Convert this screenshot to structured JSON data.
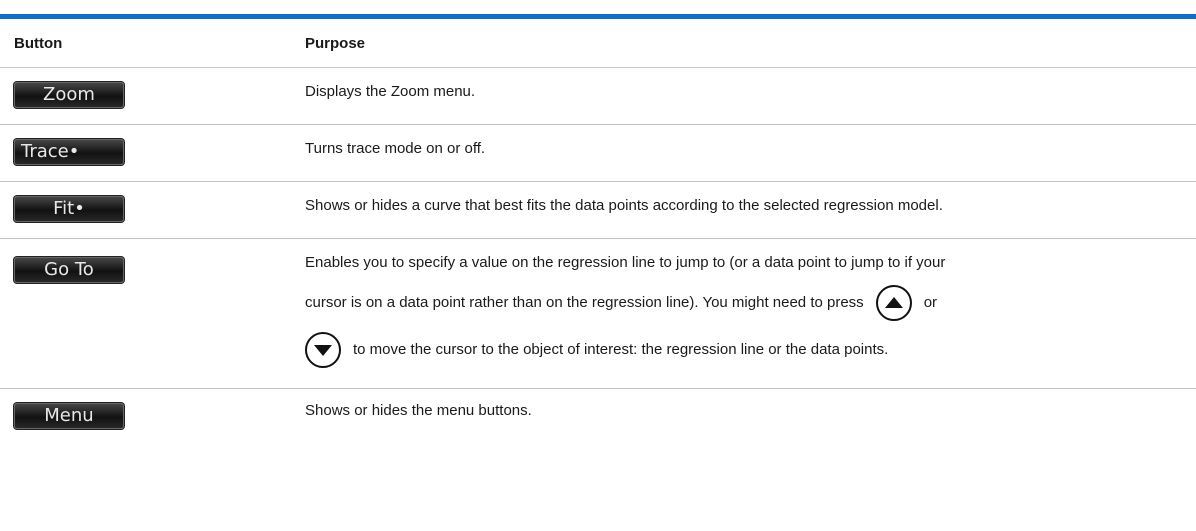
{
  "table": {
    "headers": {
      "button": "Button",
      "purpose": "Purpose"
    },
    "rows": [
      {
        "button_label": "Zoom",
        "purpose": "Displays the Zoom menu."
      },
      {
        "button_label": "Trace•",
        "purpose": "Turns trace mode on or off."
      },
      {
        "button_label": "Fit•",
        "purpose": "Shows or hides a curve that best fits the data points according to the selected regression model."
      },
      {
        "button_label": "Go To",
        "purpose_line1": "Enables you to specify a value on the regression line to jump to (or a data point to jump to if your",
        "purpose_line2_pre": "cursor is on a data point rather than on the regression line). You might need to press",
        "purpose_line2_post": "or",
        "purpose_line3": "to move the cursor to the object of interest: the regression line or the data points.",
        "icons": [
          "up-arrow-key-icon",
          "down-arrow-key-icon"
        ]
      },
      {
        "button_label": "Menu",
        "purpose": "Shows or hides the menu buttons."
      }
    ]
  },
  "colors": {
    "accent_rule": "#0a6fd0",
    "softkey_bg": "#1a1a1a",
    "softkey_text": "#e8e8e8"
  }
}
